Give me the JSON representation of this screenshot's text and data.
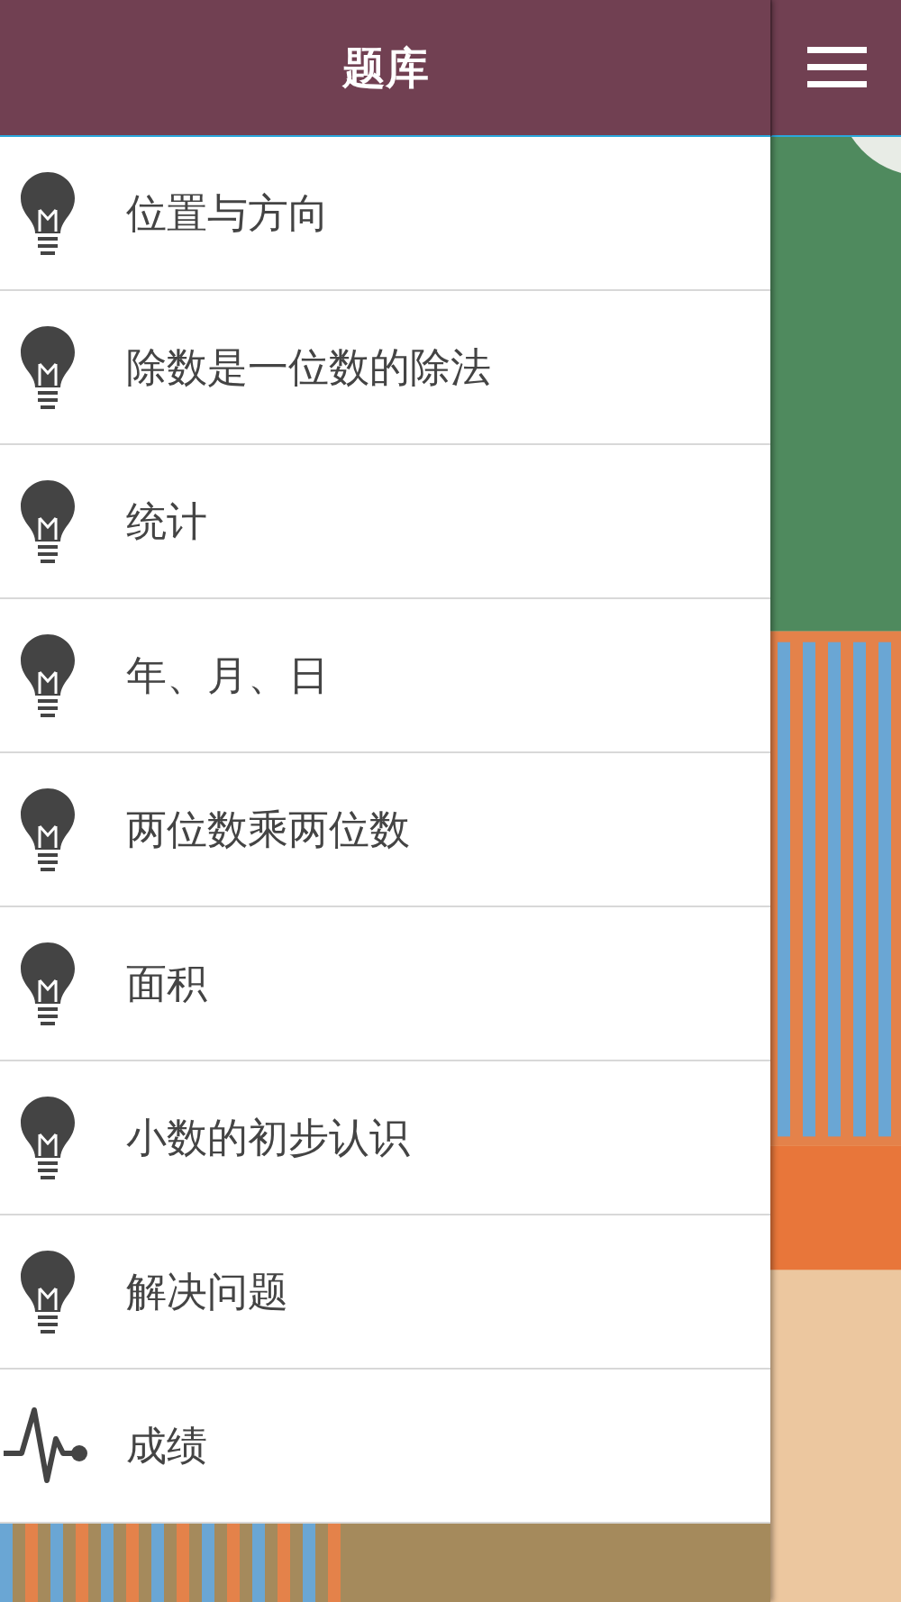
{
  "header": {
    "title": "题库"
  },
  "items": [
    {
      "label": "位置与方向",
      "kind": "bulb"
    },
    {
      "label": "除数是一位数的除法",
      "kind": "bulb"
    },
    {
      "label": "统计",
      "kind": "bulb"
    },
    {
      "label": "年、月、日",
      "kind": "bulb"
    },
    {
      "label": "两位数乘两位数",
      "kind": "bulb"
    },
    {
      "label": "面积",
      "kind": "bulb"
    },
    {
      "label": "小数的初步认识",
      "kind": "bulb"
    },
    {
      "label": "解决问题",
      "kind": "bulb"
    },
    {
      "label": "成绩",
      "kind": "pulse"
    }
  ]
}
